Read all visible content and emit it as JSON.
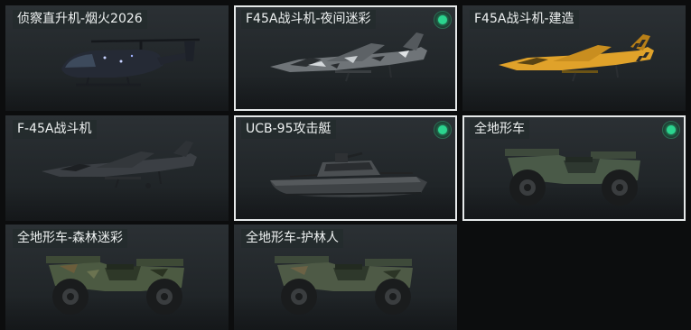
{
  "vehicles": [
    {
      "name": "侦察直升机-烟火2026",
      "owned": false,
      "selected": false,
      "icon": "helicopter-icon",
      "color": "#262a33"
    },
    {
      "name": "F45A战斗机-夜间迷彩",
      "owned": true,
      "selected": true,
      "icon": "jet-fighter-icon",
      "color": "#6f7478"
    },
    {
      "name": "F45A战斗机-建造",
      "owned": false,
      "selected": false,
      "icon": "jet-fighter-icon",
      "color": "#e0a22a"
    },
    {
      "name": "F-45A战斗机",
      "owned": false,
      "selected": false,
      "icon": "jet-fighter-icon",
      "color": "#3b3f44"
    },
    {
      "name": "UCB-95攻击艇",
      "owned": true,
      "selected": true,
      "icon": "attack-boat-icon",
      "color": "#3e4245"
    },
    {
      "name": "全地形车",
      "owned": true,
      "selected": true,
      "icon": "atv-icon",
      "color": "#4a5a48"
    },
    {
      "name": "全地形车-森林迷彩",
      "owned": false,
      "selected": false,
      "icon": "atv-icon",
      "color": "#4c5a42"
    },
    {
      "name": "全地形车-护林人",
      "owned": false,
      "selected": false,
      "icon": "atv-icon",
      "color": "#4e5a46"
    }
  ],
  "colors": {
    "owned_indicator": "#2bd48e",
    "selected_border": "#e6e9ea",
    "label_bg": "#232b2d"
  }
}
